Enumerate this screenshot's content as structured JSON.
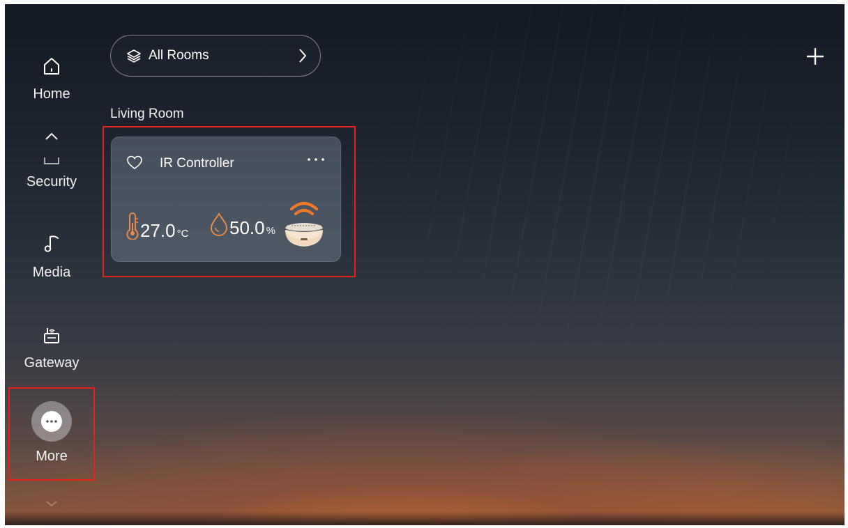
{
  "sidebar": {
    "items": [
      {
        "label": "Home",
        "icon": "home-icon"
      },
      {
        "label": "Security",
        "icon": "security-icon"
      },
      {
        "label": "Media",
        "icon": "music-note-icon"
      },
      {
        "label": "Gateway",
        "icon": "gateway-icon"
      },
      {
        "label": "More",
        "icon": "more-dots-icon"
      }
    ],
    "scroll_up_icon": "chevron-up-icon",
    "scroll_down_icon": "chevron-down-icon"
  },
  "header": {
    "room_selector_label": "All Rooms",
    "room_selector_icon": "layers-icon",
    "add_icon": "plus-icon"
  },
  "section": {
    "title": "Living Room"
  },
  "device_card": {
    "name": "IR Controller",
    "favorite_icon": "heart-outline-icon",
    "menu_icon": "ellipsis-icon",
    "temperature": {
      "value": "27.0",
      "unit": "°C"
    },
    "humidity": {
      "value": "50.0",
      "unit": "%"
    },
    "device_icon": "ir-controller-icon"
  },
  "colors": {
    "accent_orange": "#e8894a",
    "highlight_red": "#e2231a"
  }
}
